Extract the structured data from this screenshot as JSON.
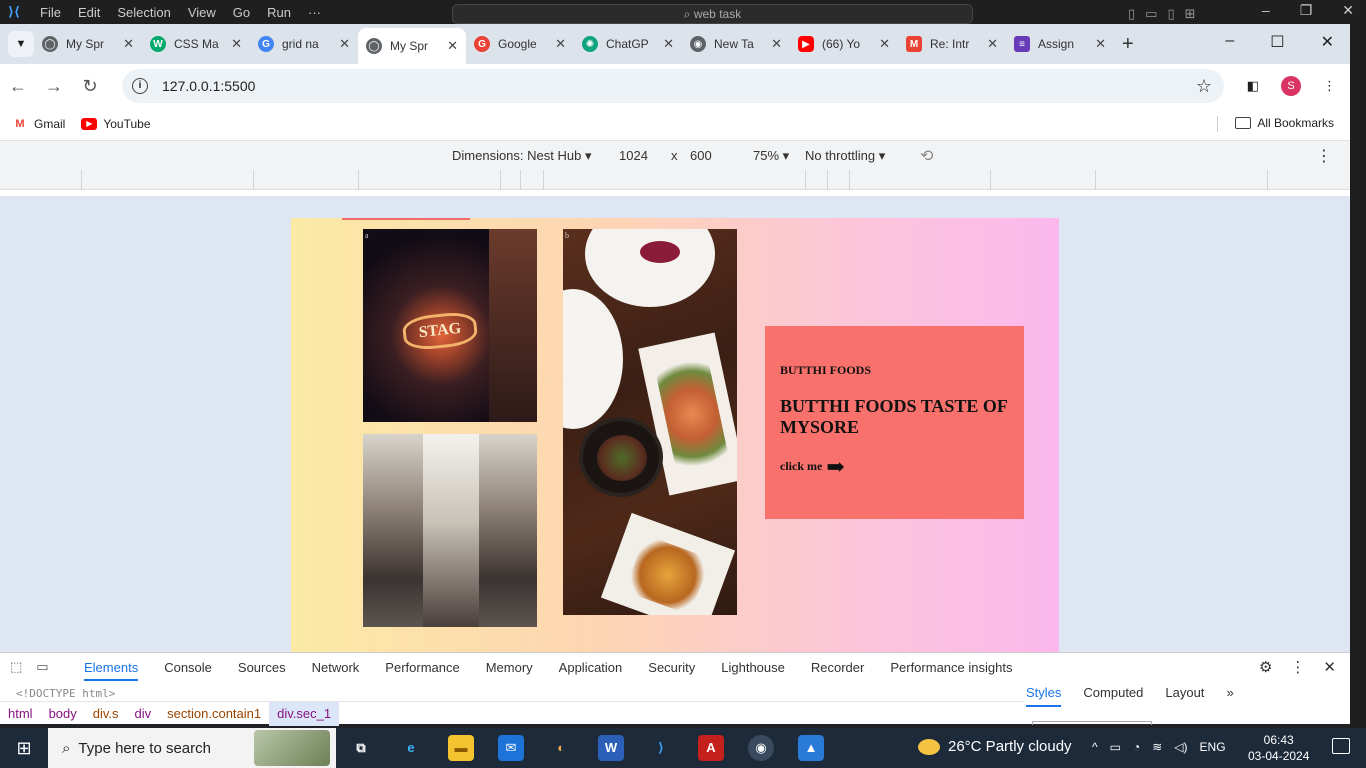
{
  "vscode": {
    "menus": [
      "File",
      "Edit",
      "Selection",
      "View",
      "Go",
      "Run",
      "···"
    ],
    "command_center": "web task"
  },
  "chrome": {
    "tabs": [
      {
        "title": "My Spr",
        "icon": "globe-icon",
        "color": "#5f6368"
      },
      {
        "title": "CSS Ma",
        "icon": "w3schools-icon",
        "color": "#04aa6d"
      },
      {
        "title": "grid na",
        "icon": "google-icon",
        "color": "#4285f4"
      },
      {
        "title": "My Spr",
        "icon": "globe-icon",
        "color": "#5f6368",
        "active": true
      },
      {
        "title": "Google",
        "icon": "google-lens-icon",
        "color": "#ea4335"
      },
      {
        "title": "ChatGP",
        "icon": "chatgpt-icon",
        "color": "#10a37f"
      },
      {
        "title": "New Ta",
        "icon": "chrome-icon",
        "color": "#5f6368"
      },
      {
        "title": "(66) Yo",
        "icon": "youtube-icon",
        "color": "#ff0000"
      },
      {
        "title": "Re: Intr",
        "icon": "gmail-icon",
        "color": "#ea4335"
      },
      {
        "title": "Assign",
        "icon": "forms-icon",
        "color": "#673ab7"
      }
    ],
    "url": "127.0.0.1:5500",
    "profile_initial": "S",
    "bookmarks": [
      {
        "label": "Gmail",
        "icon": "gmail-icon"
      },
      {
        "label": "YouTube",
        "icon": "youtube-icon"
      }
    ],
    "all_bookmarks": "All Bookmarks"
  },
  "device_toolbar": {
    "dimensions": "Dimensions: Nest Hub",
    "width": "1024",
    "times": "x",
    "height": "600",
    "zoom": "75%",
    "throttling": "No throttling"
  },
  "page": {
    "photo_labels": [
      "a",
      "b"
    ],
    "card": {
      "kicker": "BUTTHI FOODS",
      "heading": "BUTTHI FOODS TASTE OF MYSORE",
      "cta": "click me",
      "bg_color": "#f9716c"
    },
    "sign_text": "STAG"
  },
  "devtools": {
    "tabs": [
      "Elements",
      "Console",
      "Sources",
      "Network",
      "Performance",
      "Memory",
      "Application",
      "Security",
      "Lighthouse",
      "Recorder",
      "Performance insights"
    ],
    "doctype": "<!DOCTYPE html>",
    "breadcrumbs": [
      "html",
      "body",
      "div.s",
      "div",
      "section.contain1",
      "div.sec_1"
    ],
    "side_tabs": [
      "Styles",
      "Computed",
      "Layout"
    ]
  },
  "taskbar": {
    "search_placeholder": "Type here to search",
    "weather": "26°C  Partly cloudy",
    "language": "ENG",
    "time": "06:43",
    "date": "03-04-2024"
  }
}
